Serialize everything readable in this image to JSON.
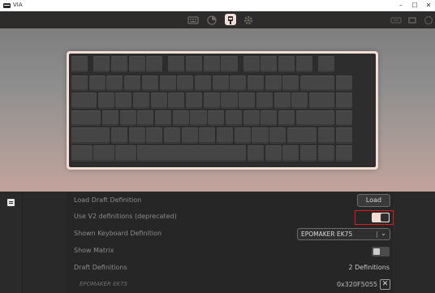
{
  "window": {
    "title": "VIA",
    "controls": {
      "minimize": "–",
      "maximize": "☐",
      "close": "✕"
    }
  },
  "topnav": {
    "icons": [
      "keyboard-icon",
      "chart-icon",
      "configure-icon",
      "settings-icon",
      "layout-icon",
      "device-icon",
      "update-icon"
    ],
    "active": "configure-icon"
  },
  "keyboard": {
    "name": "EPOMAKER EK75",
    "case_color": "#f3ddd5",
    "key_color": "#454545"
  },
  "settings": {
    "load_draft": {
      "label": "Load Draft Definition",
      "button": "Load"
    },
    "use_v2": {
      "label": "Use V2 definitions (deprecated)",
      "enabled": true
    },
    "shown_definition": {
      "label": "Shown Keyboard Definition",
      "value": "EPOMAKER EK75",
      "arrow": "⌄"
    },
    "show_matrix": {
      "label": "Show Matrix",
      "enabled": false
    },
    "draft_definitions": {
      "label": "Draft Definitions",
      "value": "2 Definitions"
    },
    "draft_item": {
      "name": "EPOMAKER EK75",
      "id": "0x320F5055",
      "remove": "✕"
    }
  },
  "colors": {
    "accent": "#f2dcd4",
    "highlight": "#e01b1b"
  }
}
